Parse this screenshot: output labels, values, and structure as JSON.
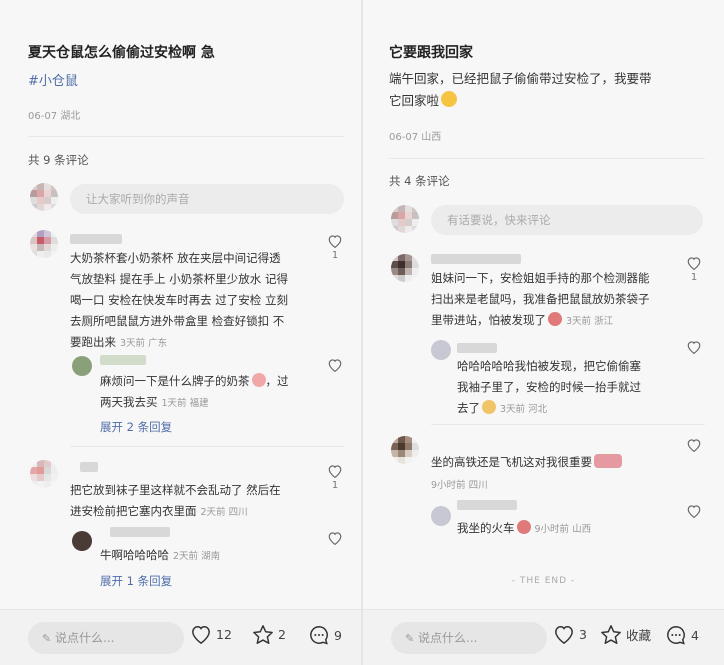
{
  "left": {
    "title": "夏天仓鼠怎么偷偷过安检啊 急",
    "tag": "#小仓鼠",
    "post_meta": "06-07 湖北",
    "comment_count": "共 9 条评论",
    "input_placeholder": "让大家听到你的声音",
    "comments": [
      {
        "lines": [
          "大奶茶杯套小奶茶杯  放在夹层中间记得透",
          "气放垫料 提在手上 小奶茶杯里少放水 记得",
          "喝一口 安检在快发车时再去 过了安检 立刻",
          "去厕所吧鼠鼠方进外带盒里  检查好锁扣 不"
        ],
        "last_line": "要跑出来",
        "meta": "3天前 广东",
        "likes": "1"
      },
      {
        "lines": [
          "麻烦问一下是什么牌子的奶茶"
        ],
        "line1_suffix": "，过",
        "last_line": "两天我去买",
        "meta": "1天前 福建",
        "expand": "展开 2 条回复"
      },
      {
        "lines": [
          "把它放到袜子里这样就不会乱动了 然后在"
        ],
        "last_line": "进安检前把它塞内衣里面",
        "meta": "2天前 四川",
        "likes": "1"
      },
      {
        "last_line": "牛啊哈哈哈哈",
        "meta": "2天前 湖南",
        "expand": "展开 1 条回复"
      }
    ],
    "bar": {
      "say": "说点什么...",
      "likes": "12",
      "stars": "2",
      "comments": "9"
    }
  },
  "right": {
    "title": "它要跟我回家",
    "body_line1": "端午回家，已经把鼠子偷偷带过安检了，我要带",
    "body_line2": "它回家啦",
    "post_meta": "06-07 山西",
    "comment_count": "共 4 条评论",
    "input_placeholder": "有话要说，快来评论",
    "comments": [
      {
        "lines": [
          "姐妹问一下，安检姐姐手持的那个检测器能",
          "扫出来是老鼠吗，我准备把鼠鼠放奶茶袋子"
        ],
        "last_line": "里带进站，怕被发现了",
        "meta": "3天前 浙江",
        "likes": "1"
      },
      {
        "lines": [
          "哈哈哈哈哈我怕被发现，把它偷偷塞",
          "我袖子里了，安检的时候一抬手就过"
        ],
        "last_line": "去了",
        "meta": "3天前 河北"
      },
      {
        "last_line": "坐的高铁还是飞机这对我很重要",
        "meta": "9小时前 四川"
      },
      {
        "last_line": "我坐的火车",
        "meta": "9小时前 山西"
      }
    ],
    "end_text": "- THE END -",
    "bar": {
      "say": "说点什么...",
      "likes": "3",
      "collect": "收藏",
      "comments": "4"
    }
  },
  "colors": {
    "link": "#4f6ea8",
    "background": "#f7f7f7",
    "meta": "#9a9a9a"
  },
  "icons": [
    "heart-icon",
    "star-icon",
    "comment-icon",
    "pencil-icon",
    "emoji-icon"
  ]
}
